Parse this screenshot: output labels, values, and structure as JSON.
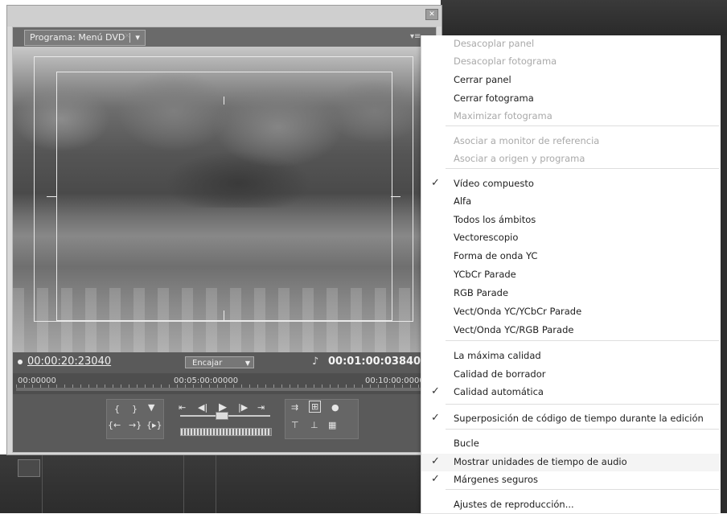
{
  "panel": {
    "tab_label": "Programa: Menú DVD",
    "tab_close": "×",
    "timecode_current": "00:00:20:23040",
    "fit_label": "Encajar",
    "timecode_duration": "00:01:00:03840",
    "ruler_labels": [
      "00:00000",
      "00:05:00:00000",
      "00:10:00:00000"
    ]
  },
  "menu": {
    "items": [
      {
        "label": "Desacoplar panel",
        "enabled": false,
        "checked": false
      },
      {
        "label": "Desacoplar fotograma",
        "enabled": false,
        "checked": false
      },
      {
        "label": "Cerrar panel",
        "enabled": true,
        "checked": false
      },
      {
        "label": "Cerrar fotograma",
        "enabled": true,
        "checked": false
      },
      {
        "label": "Maximizar fotograma",
        "enabled": false,
        "checked": false
      },
      {
        "label": "Asociar a monitor de referencia",
        "enabled": false,
        "checked": false
      },
      {
        "label": "Asociar a origen y programa",
        "enabled": false,
        "checked": false
      },
      {
        "label": "Vídeo compuesto",
        "enabled": true,
        "checked": true
      },
      {
        "label": "Alfa",
        "enabled": true,
        "checked": false
      },
      {
        "label": "Todos los ámbitos",
        "enabled": true,
        "checked": false
      },
      {
        "label": "Vectorescopio",
        "enabled": true,
        "checked": false
      },
      {
        "label": "Forma de onda YC",
        "enabled": true,
        "checked": false
      },
      {
        "label": "YCbCr Parade",
        "enabled": true,
        "checked": false
      },
      {
        "label": "RGB Parade",
        "enabled": true,
        "checked": false
      },
      {
        "label": "Vect/Onda YC/YCbCr Parade",
        "enabled": true,
        "checked": false
      },
      {
        "label": "Vect/Onda YC/RGB Parade",
        "enabled": true,
        "checked": false
      },
      {
        "label": "La máxima calidad",
        "enabled": true,
        "checked": false
      },
      {
        "label": "Calidad de borrador",
        "enabled": true,
        "checked": false
      },
      {
        "label": "Calidad automática",
        "enabled": true,
        "checked": true
      },
      {
        "label": "Superposición de código de tiempo durante la edición",
        "enabled": true,
        "checked": true
      },
      {
        "label": "Bucle",
        "enabled": true,
        "checked": false
      },
      {
        "label": "Mostrar unidades de tiempo de audio",
        "enabled": true,
        "checked": true
      },
      {
        "label": "Márgenes seguros",
        "enabled": true,
        "checked": true
      },
      {
        "label": "Ajustes de reproducción...",
        "enabled": true,
        "checked": false
      }
    ],
    "check_glyph": "✓"
  }
}
